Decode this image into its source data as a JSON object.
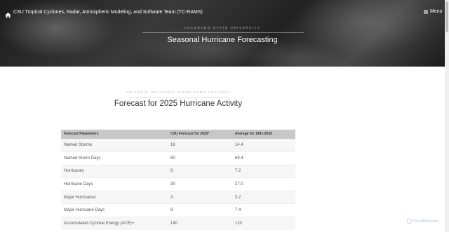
{
  "header": {
    "site_title": "CSU Tropical Cyclones, Radar, Atmospheric Modeling, and Software Team (TC-RAMS)",
    "menu_label": "Menu",
    "kicker": "COLORADO STATE UNIVERSITY",
    "page_title": "Seasonal Hurricane Forecasting"
  },
  "section": {
    "kicker": "ATLANTIC SEASONAL HURRICANE ACTIVITY",
    "title": "Forecast for 2025 Hurricane Activity"
  },
  "table": {
    "headers": [
      "Forecast Parameters",
      "CSU Forecast for 2025*",
      "Average for 1991-2020"
    ],
    "rows": [
      [
        "Named Storms",
        "16",
        "14.4"
      ],
      [
        "Named Storm Days",
        "80",
        "69.4"
      ],
      [
        "Hurricanes",
        "8",
        "7.2"
      ],
      [
        "Hurricane Days",
        "30",
        "27.0"
      ],
      [
        "Major Hurricanes",
        "3",
        "3.2"
      ],
      [
        "Major Hurricane Days",
        "8",
        "7.4"
      ],
      [
        "Accumulated Cyclone Energy (ACE)+",
        "140",
        "123"
      ]
    ]
  },
  "watermark": "ScanMalware",
  "icons": {
    "home": "home-icon",
    "menu": "menu-icon",
    "watermark": "scan-icon"
  }
}
